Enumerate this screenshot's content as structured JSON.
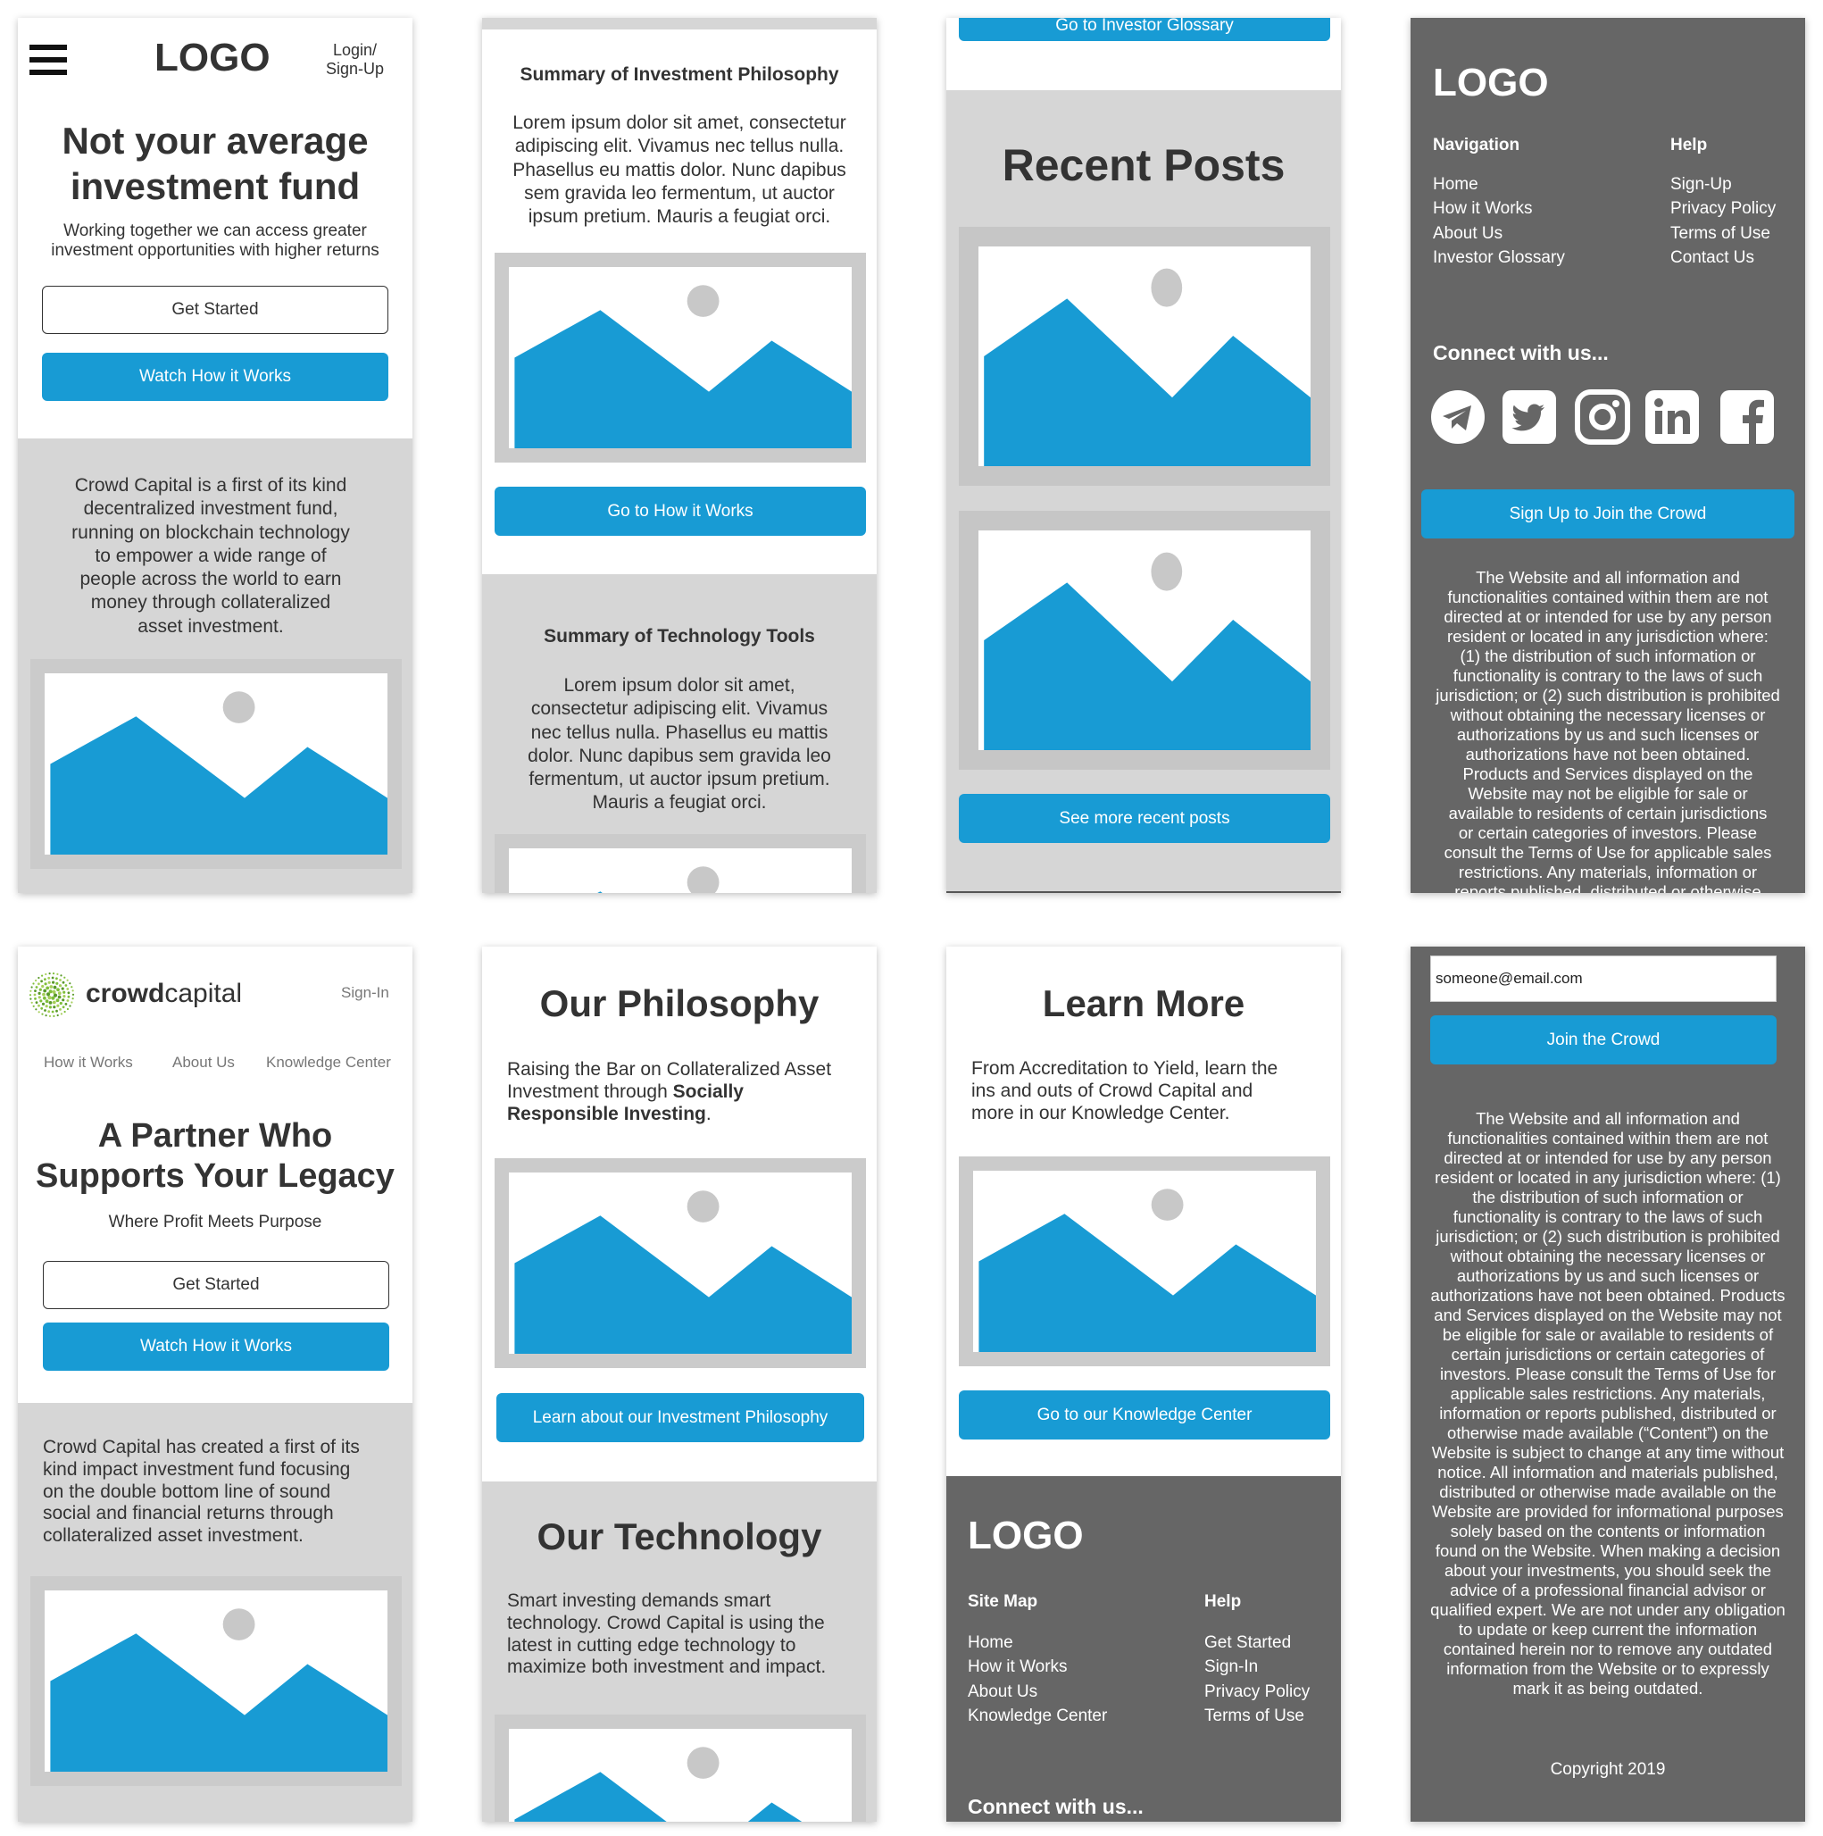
{
  "p1": {
    "logo": "LOGO",
    "login_line1": "Login/",
    "login_line2": "Sign-Up",
    "heading_line1": "Not your average",
    "heading_line2": "investment fund",
    "sub_line1": "Working together we can access greater",
    "sub_line2": "investment opportunities with higher returns",
    "get_started": "Get Started",
    "watch": "Watch How it Works",
    "body_lines": [
      "Crowd Capital is a first of its kind",
      "decentralized investment fund,",
      "running on blockchain technology",
      "to empower a wide range of",
      "people across the world to earn",
      "money through collateralized",
      "asset investment."
    ]
  },
  "p2": {
    "title1": "Summary of Investment Philosophy",
    "body1_lines": [
      "Lorem ipsum dolor sit amet, consectetur",
      "adipiscing elit. Vivamus nec tellus nulla.",
      "Phasellus eu mattis dolor. Nunc dapibus",
      "sem gravida leo fermentum, ut auctor",
      "ipsum pretium. Mauris a feugiat orci."
    ],
    "button": "Go to How it Works",
    "title2": "Summary of Technology Tools",
    "body2_lines": [
      "Lorem ipsum dolor sit amet,",
      "consectetur adipiscing elit. Vivamus",
      "nec tellus nulla. Phasellus eu mattis",
      "dolor. Nunc dapibus sem gravida leo",
      "fermentum, ut auctor ipsum pretium.",
      "Mauris a feugiat orci."
    ]
  },
  "p3": {
    "top_button": "Go to Investor Glossary",
    "heading": "Recent Posts",
    "button": "See more recent posts"
  },
  "p4": {
    "logo": "LOGO",
    "nav_head": "Navigation",
    "nav_items": [
      "Home",
      "How it Works",
      "About Us",
      "Investor Glossary"
    ],
    "help_head": "Help",
    "help_items": [
      "Sign-Up",
      "Privacy Policy",
      "Terms of Use",
      "Contact Us"
    ],
    "connect": "Connect with us...",
    "signup_button": "Sign Up to Join the Crowd",
    "legal_lines": [
      "The Website and all information and",
      "functionalities contained within them are not",
      "directed at or intended for use by any person",
      "resident or located in any jurisdiction where:",
      "(1) the distribution of such information or",
      "functionality is contrary to the laws of such",
      "jurisdiction; or (2) such distribution is prohibited",
      "without obtaining the necessary licenses or",
      "authorizations by us and such licenses or",
      "authorizations have not been obtained.",
      "Products and Services displayed on the",
      "Website may not be eligible for sale or",
      "available to residents of certain jurisdictions",
      "or certain categories of investors. Please",
      "consult the Terms of Use for applicable sales",
      "restrictions. Any materials, information or",
      "reports published, distributed or otherwise"
    ]
  },
  "p5": {
    "brand_bold": "crowd",
    "brand_light": "capital",
    "signin": "Sign-In",
    "nav": [
      "How it Works",
      "About Us",
      "Knowledge Center"
    ],
    "heading_line1": "A Partner Who",
    "heading_line2": "Supports Your Legacy",
    "sub": "Where Profit Meets Purpose",
    "get_started": "Get Started",
    "watch": "Watch How it Works",
    "body_lines": [
      "Crowd Capital has created a first of its",
      "kind impact investment fund focusing",
      "on the double bottom line of sound",
      "social and financial returns through",
      "collateralized asset investment."
    ]
  },
  "p6": {
    "heading1": "Our Philosophy",
    "body1_line1": "Raising the Bar on Collateralized Asset",
    "body1_line2_plain": "Investment through ",
    "body1_line2_bold": "Socially",
    "body1_line3_bold": "Responsible Investing",
    "body1_line3_end": ".",
    "button": "Learn about our Investment Philosophy",
    "heading2": "Our Technology",
    "body2_lines": [
      "Smart investing demands smart",
      "technology. Crowd Capital is using the",
      "latest in cutting edge technology to",
      "maximize both investment and impact."
    ]
  },
  "p7": {
    "heading": "Learn More",
    "body_lines": [
      "From Accreditation to Yield, learn the",
      "ins and outs of Crowd Capital and",
      "more in our Knowledge Center."
    ],
    "button": "Go to our Knowledge Center",
    "logo": "LOGO",
    "sitemap_head": "Site Map",
    "sitemap_items": [
      "Home",
      "How it Works",
      "About Us",
      "Knowledge Center"
    ],
    "help_head": "Help",
    "help_items": [
      "Get Started",
      "Sign-In",
      "Privacy Policy",
      "Terms of Use"
    ],
    "connect": "Connect with us..."
  },
  "p8": {
    "email_value": "someone@email.com",
    "join_button": "Join the Crowd",
    "legal_lines": [
      "The Website and all information and",
      "functionalities contained within them are not",
      "directed at or intended for use by any person",
      "resident or located in any jurisdiction where: (1)",
      "the distribution of such information or",
      "functionality is contrary to the laws of such",
      "jurisdiction; or (2) such distribution is prohibited",
      "without obtaining the necessary licenses or",
      "authorizations by us and such licenses or",
      "authorizations have not been obtained. Products",
      "and Services displayed on the Website may not",
      "be eligible for sale or available to residents of",
      "certain jurisdictions or certain categories of",
      "investors. Please consult the Terms of Use for",
      "applicable sales restrictions. Any materials,",
      "information or reports published, distributed or",
      "otherwise made available (“Content”) on the",
      "Website is subject to change at any time without",
      "notice. All information and materials published,",
      "distributed or otherwise made available on the",
      "Website are provided for informational purposes",
      "solely based on the contents or information",
      "found on the Website. When making a decision",
      "about your investments, you should seek the",
      "advice of a professional financial advisor or",
      "qualified expert. We are not under any obligation",
      "to update or keep current the information",
      "contained herein nor to remove any outdated",
      "information from the Website or to expressly",
      "mark it as being outdated."
    ],
    "copyright": "Copyright 2019"
  },
  "colors": {
    "accent": "#189bd4",
    "light_gray": "#d6d6d6",
    "dark_gray": "#666666",
    "placeholder_sun": "#c8c8c8"
  },
  "icons": [
    "hamburger-menu-icon",
    "image-placeholder-icon",
    "telegram-icon",
    "twitter-icon",
    "instagram-icon",
    "linkedin-icon",
    "facebook-icon",
    "crowdcapital-logo-icon"
  ]
}
